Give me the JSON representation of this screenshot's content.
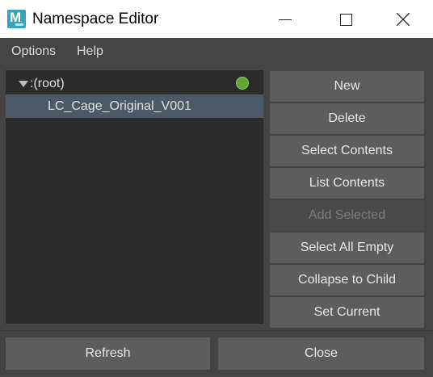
{
  "window": {
    "title": "Namespace Editor",
    "app_icon_letter": "M",
    "controls": [
      "minimize-icon",
      "maximize-icon",
      "close-icon"
    ]
  },
  "menu": {
    "options": "Options",
    "help": "Help"
  },
  "tree": {
    "root_label": ":(root)",
    "child_label": "LC_Cage_Original_V001"
  },
  "buttons": {
    "new": "New",
    "delete": "Delete",
    "select_contents": "Select Contents",
    "list_contents": "List Contents",
    "add_selected": "Add Selected",
    "select_all_empty": "Select All Empty",
    "collapse_to_child": "Collapse to Child",
    "set_current": "Set Current",
    "refresh": "Refresh",
    "close": "Close"
  },
  "colors": {
    "accent_icon": "#37a5b5",
    "current_indicator": "#61a635",
    "selected_row": "#4c5a67"
  }
}
